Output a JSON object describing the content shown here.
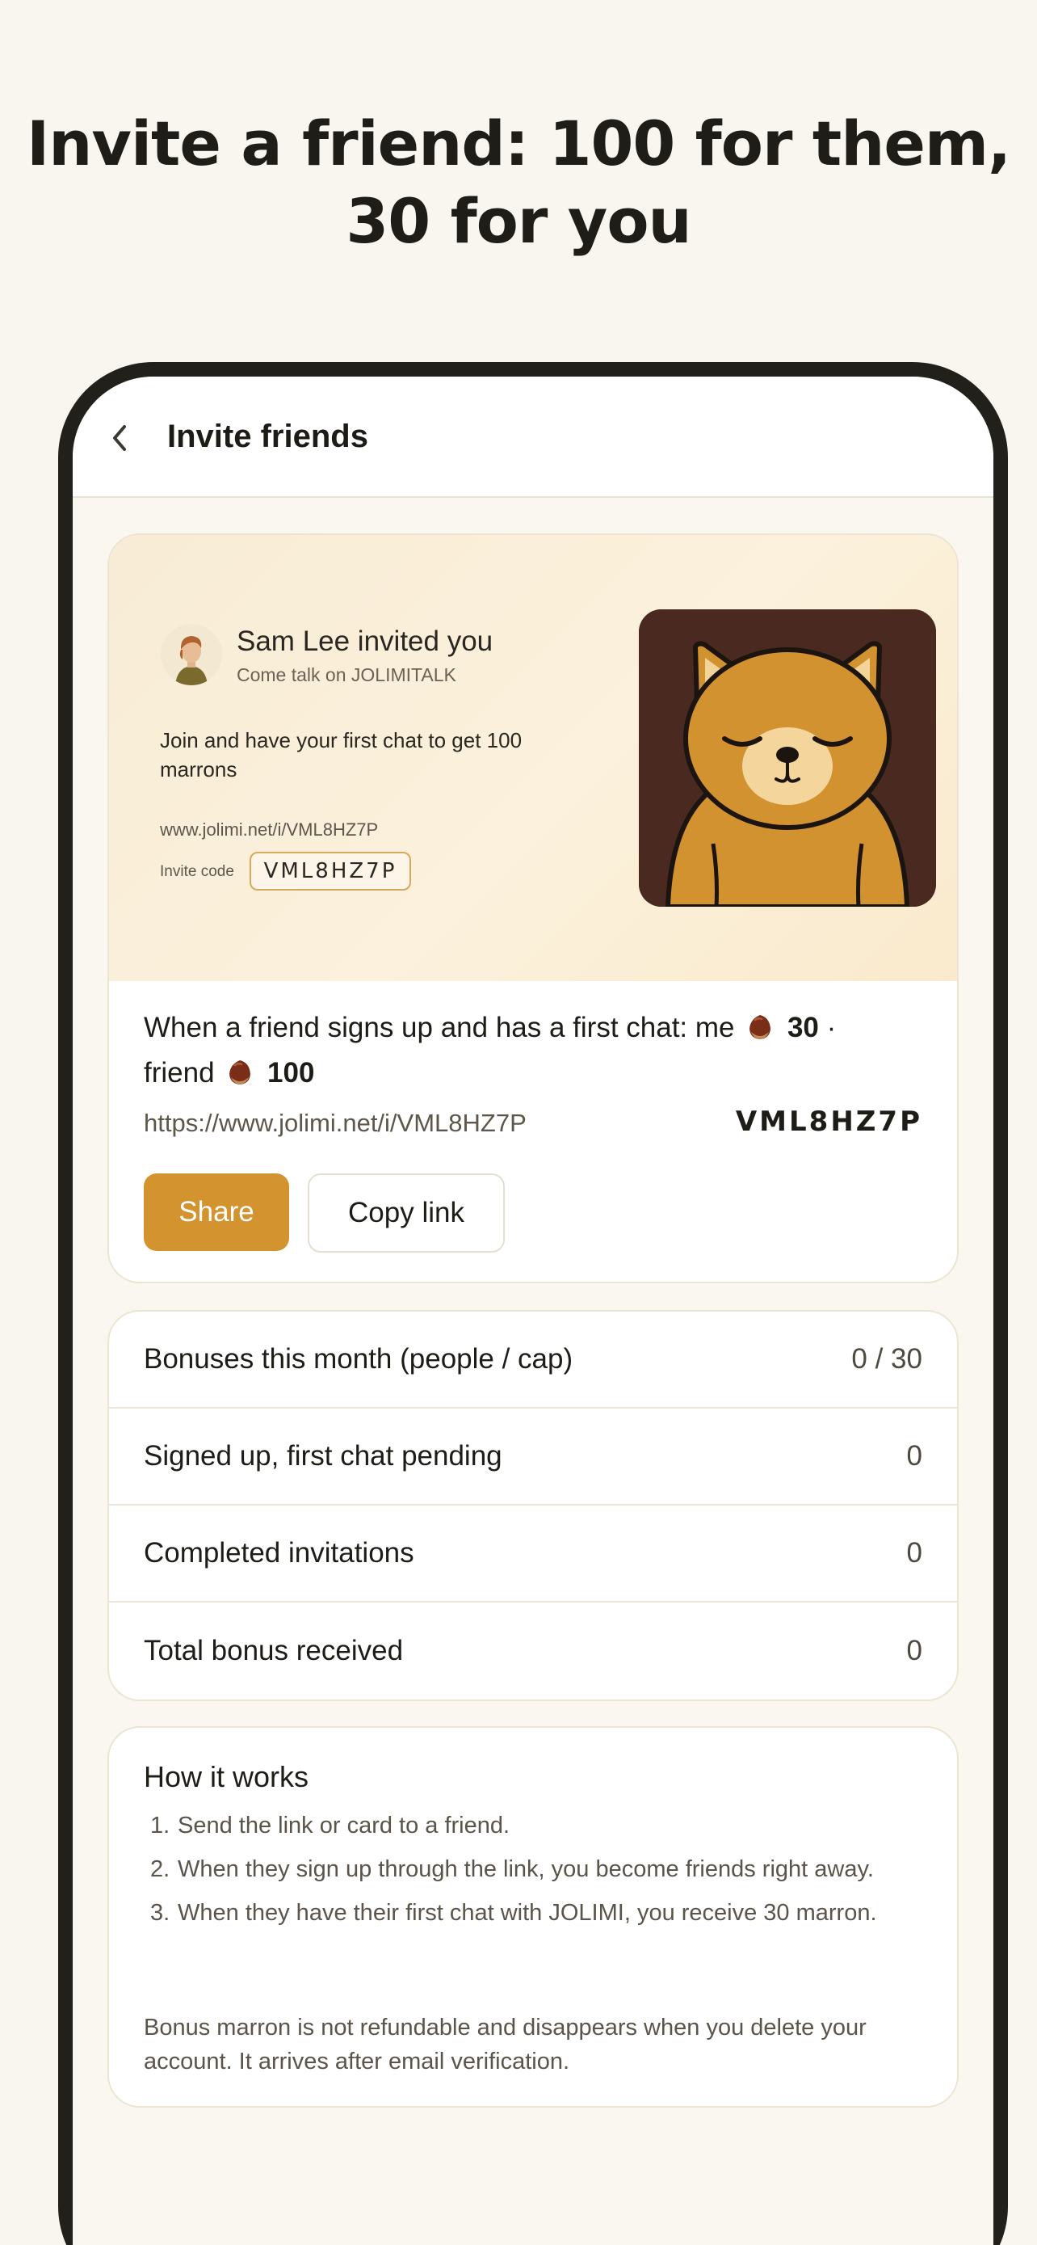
{
  "headline": {
    "line1": "Invite a friend: 100 for them,",
    "line2": "30 for you"
  },
  "navbar": {
    "back_icon": "chevron-left-icon",
    "title": "Invite friends"
  },
  "invite_card": {
    "inviter": "Sam Lee invited you",
    "inviter_sub": "Come talk on JOLIMITALK",
    "join_text": "Join and have your first chat to get 100 marrons",
    "link": "www.jolimi.net/i/VML8HZ7P",
    "code_label": "Invite code",
    "code": "VML8HZ7P",
    "mascot": "sleeping-shiba-dog-illustration",
    "reward_prefix": "When a friend signs up and has a first chat: me",
    "reward_me": "30",
    "reward_sep": "·",
    "reward_friend_label": "friend",
    "reward_friend": "100",
    "reward_icon": "chestnut-icon",
    "full_link": "https://www.jolimi.net/i/VML8HZ7P",
    "code_display": "VML8HZ7P",
    "share_label": "Share",
    "copy_label": "Copy link"
  },
  "stats": [
    {
      "label": "Bonuses this month (people / cap)",
      "value": "0 / 30"
    },
    {
      "label": "Signed up, first chat pending",
      "value": "0"
    },
    {
      "label": "Completed invitations",
      "value": "0"
    },
    {
      "label": "Total bonus received",
      "value": "0"
    }
  ],
  "how_it_works": {
    "title": "How it works",
    "steps": [
      "Send the link or card to a friend.",
      "When they sign up through the link, you become friends right away.",
      "When they have their first chat with JOLIMI, you receive 30 marron."
    ],
    "note": "Bonus marron is not refundable and disappears when you delete your account. It arrives after email verification."
  },
  "colors": {
    "accent": "#d3942f",
    "background": "#f8f6ef",
    "phone_frame": "#22201b",
    "mascot_bg": "#4a2a20"
  }
}
